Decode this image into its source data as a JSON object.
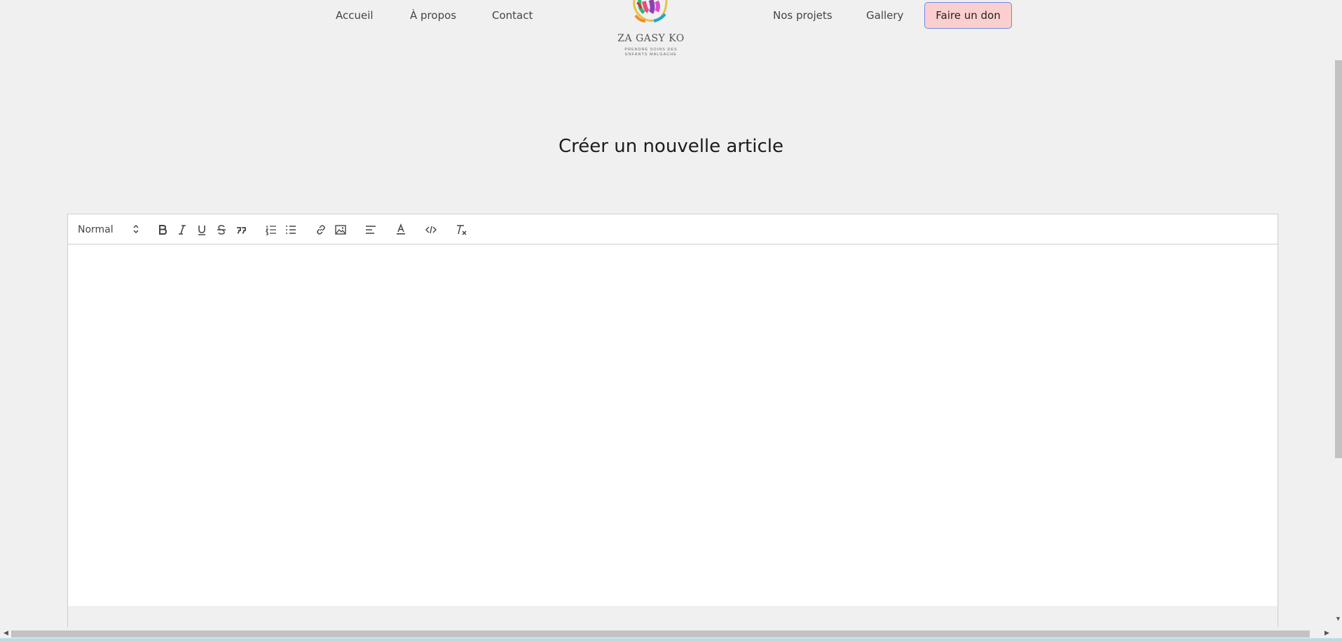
{
  "nav": {
    "accueil": "Accueil",
    "apropos": "À propos",
    "contact": "Contact",
    "projets": "Nos projets",
    "gallery": "Gallery",
    "donate": "Faire un don"
  },
  "logo": {
    "title": "ZA GASY KO",
    "subtitle_line1": "PRENDRE SOINS DES",
    "subtitle_line2": "ENFANTS MALGACHE"
  },
  "page": {
    "title": "Créer un nouvelle article"
  },
  "editor": {
    "header_select": "Normal",
    "toolbar_icons": [
      "bold-icon",
      "italic-icon",
      "underline-icon",
      "strike-icon",
      "blockquote-icon",
      "ordered-list-icon",
      "bullet-list-icon",
      "link-icon",
      "image-icon",
      "align-icon",
      "text-color-icon",
      "code-icon",
      "clear-format-icon"
    ]
  },
  "colors": {
    "background": "#f0f0f0",
    "donate_bg": "#fccfcf",
    "donate_border": "#6e86e6",
    "editor_bg": "#ffffff",
    "editor_border": "#cccccc"
  }
}
